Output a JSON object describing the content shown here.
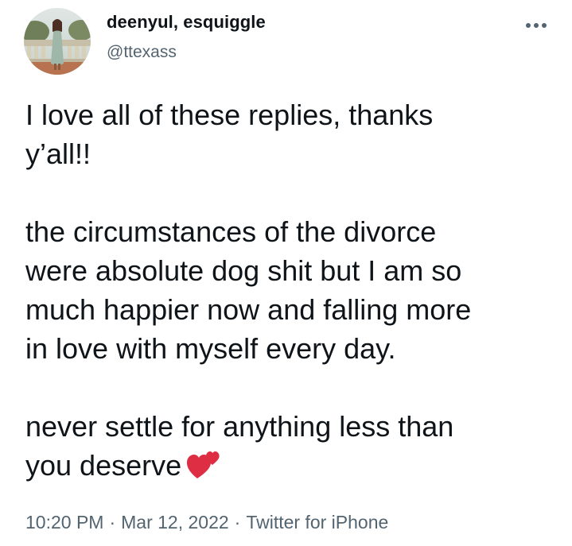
{
  "author": {
    "display_name": "deenyul, esquiggle",
    "handle": "@ttexass"
  },
  "tweet": {
    "paragraphs": [
      [
        "I love all of these replies, thanks",
        "y’all!!"
      ],
      [
        "the circumstances of the divorce",
        "were absolute dog shit but I am so",
        "much happier now and falling more",
        "in love with myself every day."
      ],
      [
        "never settle for anything less than",
        "you deserve"
      ]
    ],
    "emoji": "two-hearts"
  },
  "meta": {
    "time": "10:20 PM",
    "date": "Mar 12, 2022",
    "source": "Twitter for iPhone",
    "separator": "·"
  },
  "icons": {
    "more": "more-horizontal-icon",
    "emoji": "two-hearts-icon"
  },
  "colors": {
    "text_primary": "#0f1419",
    "text_secondary": "#536471",
    "heart": "#e0245e"
  }
}
